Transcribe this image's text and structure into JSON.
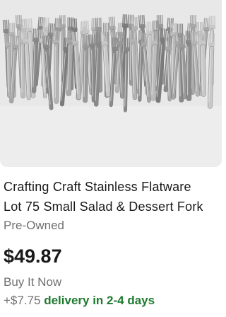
{
  "listing": {
    "image": {
      "icon": "fork-bundle-photo"
    },
    "title_line1": "Crafting Craft Stainless Flatware",
    "title_line2": "Lot 75 Small Salad & Dessert Fork",
    "condition": "Pre-Owned",
    "price": "$49.87",
    "buy_format": "Buy It Now",
    "shipping_cost": "+$7.75",
    "delivery": "delivery in 2-4 days"
  },
  "colors": {
    "image_background": "#ededed",
    "text_primary": "#191919",
    "text_secondary": "#707070",
    "delivery_green": "#1e7a2f"
  }
}
